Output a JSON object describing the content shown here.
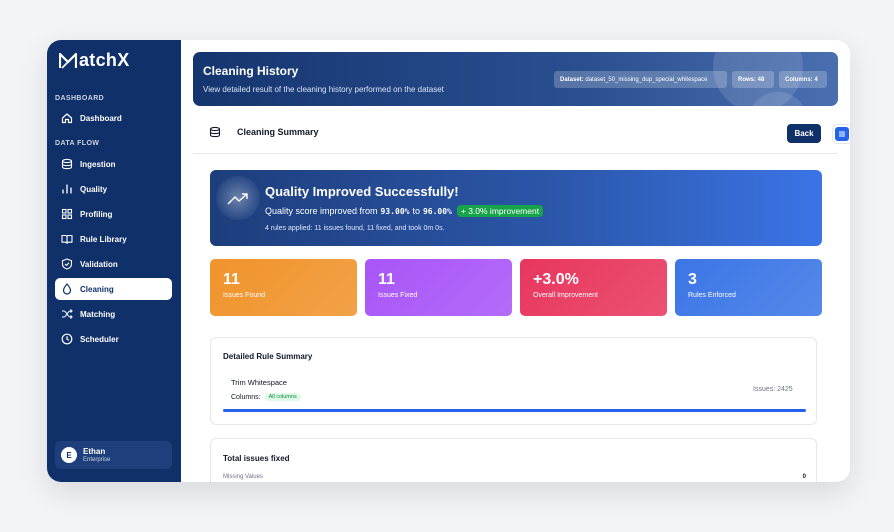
{
  "app": {
    "logo_text": "atchX"
  },
  "sidebar": {
    "section_dashboard": "DASHBOARD",
    "section_dataflow": "DATA FLOW",
    "items": [
      {
        "label": "Dashboard",
        "icon": "home-icon"
      },
      {
        "label": "Ingestion",
        "icon": "database-icon"
      },
      {
        "label": "Quality",
        "icon": "bar-chart-icon"
      },
      {
        "label": "Profiling",
        "icon": "grid-icon"
      },
      {
        "label": "Rule Library",
        "icon": "book-icon"
      },
      {
        "label": "Validation",
        "icon": "shield-check-icon"
      },
      {
        "label": "Cleaning",
        "icon": "droplet-icon",
        "active": true
      },
      {
        "label": "Matching",
        "icon": "shuffle-icon"
      },
      {
        "label": "Scheduler",
        "icon": "clock-icon"
      }
    ],
    "user": {
      "initial": "E",
      "name": "Ethan",
      "plan": "Enterprise"
    }
  },
  "header": {
    "title": "Cleaning History",
    "subtitle": "View detailed result of the cleaning history performed on the dataset",
    "dataset_label": "Dataset:",
    "dataset_value": "dataset_50_missing_dup_special_whitespace",
    "rows": "Rows: 48",
    "columns": "Columns: 4"
  },
  "summary": {
    "title": "Cleaning Summary",
    "back_label": "Back"
  },
  "quality": {
    "title": "Quality Improved Successfully!",
    "text_prefix": "Quality score improved from",
    "from_score": "93.00%",
    "to_word": "to",
    "to_score": "96.00%",
    "improvement": "+ 3.0% improvement",
    "note": "4 rules applied: 11 issues found, 11 fixed, and took 0m 0s."
  },
  "stats": [
    {
      "value": "11",
      "label": "Issues Found",
      "color": "#f0932b"
    },
    {
      "value": "11",
      "label": "Issues Fixed",
      "color": "#a855f7"
    },
    {
      "value": "+3.0%",
      "label": "Overall Improvement",
      "color": "#e8365d"
    },
    {
      "value": "3",
      "label": "Rules Enforced",
      "color": "#3b76e6"
    }
  ],
  "rule_summary": {
    "title": "Detailed Rule Summary",
    "rule_name": "Trim Whitespace",
    "columns_label": "Columns:",
    "columns_chip": "All columns",
    "issues": "Issues: 2425"
  },
  "total_fixed": {
    "title": "Total issues fixed",
    "row_label": "Missing Values",
    "row_value": "0"
  }
}
